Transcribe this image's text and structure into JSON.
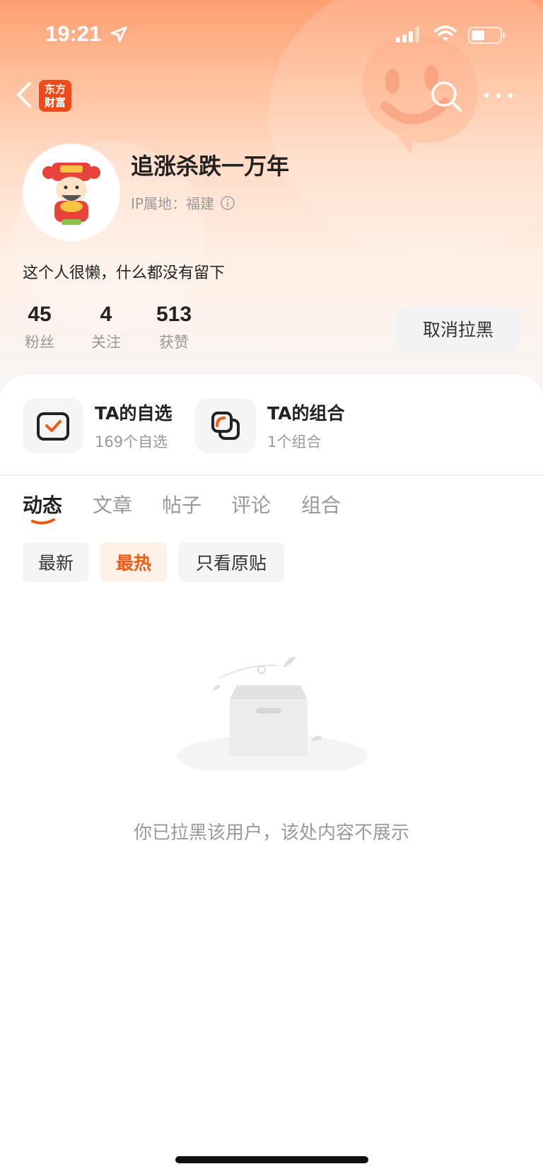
{
  "status_bar": {
    "time": "19:21"
  },
  "header": {
    "logo_text": "东方财富"
  },
  "profile": {
    "username": "追涨杀跌一万年",
    "ip_location": "IP属地：福建",
    "bio": "这个人很懒，什么都没有留下",
    "stats": [
      {
        "value": "45",
        "label": "粉丝"
      },
      {
        "value": "4",
        "label": "关注"
      },
      {
        "value": "513",
        "label": "获赞"
      }
    ],
    "unblock_label": "取消拉黑"
  },
  "shortcuts": [
    {
      "title": "TA的自选",
      "subtitle": "169个自选"
    },
    {
      "title": "TA的组合",
      "subtitle": "1个组合"
    }
  ],
  "tabs": [
    "动态",
    "文章",
    "帖子",
    "评论",
    "组合"
  ],
  "active_tab": "动态",
  "filters": [
    "最新",
    "最热",
    "只看原贴"
  ],
  "active_filter": "最热",
  "empty_message": "你已拉黑该用户，该处内容不展示",
  "colors": {
    "accent": "#f05a12",
    "logo_bg": "#f04a1a",
    "header_top": "#ff9f72"
  }
}
